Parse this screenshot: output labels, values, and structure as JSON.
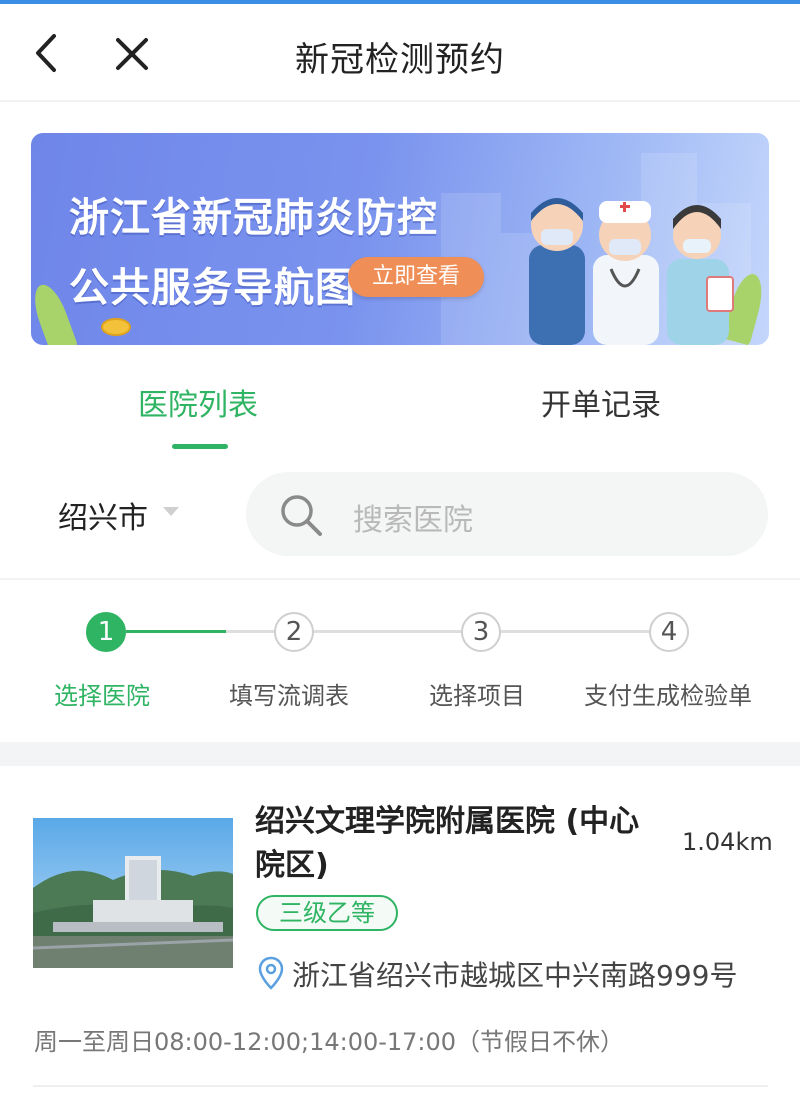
{
  "header": {
    "title": "新冠检测预约",
    "back_icon": "chevron-left-icon",
    "close_icon": "close-icon"
  },
  "banner": {
    "line1": "浙江省新冠肺炎防控",
    "line2": "公共服务导航图",
    "cta": "立即查看"
  },
  "tabs": [
    {
      "label": "医院列表",
      "active": true
    },
    {
      "label": "开单记录",
      "active": false
    }
  ],
  "filter": {
    "city": "绍兴市",
    "search_placeholder": "搜索医院"
  },
  "steps": [
    {
      "number": "1",
      "label": "选择医院",
      "active": true
    },
    {
      "number": "2",
      "label": "填写流调表",
      "active": false
    },
    {
      "number": "3",
      "label": "选择项目",
      "active": false
    },
    {
      "number": "4",
      "label": "支付生成检验单",
      "active": false
    }
  ],
  "hospital": {
    "name": "绍兴文理学院附属医院 (中心院区)",
    "distance": "1.04km",
    "level": "三级乙等",
    "address": "浙江省绍兴市越城区中兴南路999号",
    "hours": "周一至周日08:00-12:00;14:00-17:00（节假日不休）"
  },
  "colors": {
    "accent": "#2fb463",
    "banner_bg": "#7a93ee",
    "cta": "#ef8f57"
  }
}
